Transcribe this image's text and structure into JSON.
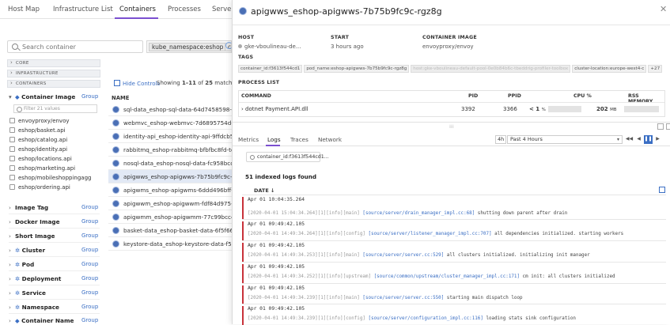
{
  "nav": {
    "tabs": [
      "Host Map",
      "Infrastructure List",
      "Containers",
      "Processes",
      "Serverless"
    ]
  },
  "left": {
    "search_placeholder": "Search container",
    "filter_chip": "kube_namespace:eshop ✖",
    "filter_chip2": "co",
    "sections": [
      "CORE",
      "INFRASTRUCTURE",
      "CONTAINERS"
    ],
    "container_image_label": "Container Image",
    "group_label": "Group",
    "filter_values_placeholder": "Filter 21 values",
    "images": [
      "envoyproxy/envoy",
      "eshop/basket.api",
      "eshop/catalog.api",
      "eshop/identity.api",
      "eshop/locations.api",
      "eshop/marketing.api",
      "eshop/mobileshoppingagg",
      "eshop/ordering.api"
    ],
    "facets": [
      "Image Tag",
      "Docker Image",
      "Short Image",
      "Cluster",
      "Pod",
      "Deployment",
      "Service",
      "Namespace",
      "Container Name"
    ]
  },
  "list": {
    "hide_controls": "Hide Controls",
    "showing_prefix": "Showing ",
    "showing_range": "1–11",
    "showing_of": " of ",
    "showing_count": "25",
    "showing_suffix": " matching co",
    "name_col": "NAME",
    "rows": [
      "sql-data_eshop-sql-data-64d7458598-892ln",
      "webmvc_eshop-webmvc-7d6895754d-7x4hn",
      "identity-api_eshop-identity-api-9ffdcb57b-jh7x",
      "rabbitmq_eshop-rabbitmq-bfbfbc8fd-tc6s2",
      "nosql-data_eshop-nosql-data-fc958bcc8-56n2v",
      "apigwws_eshop-apigwws-7b75b9fc9c-rgz8g",
      "apigwms_eshop-apigwms-6ddd496bff-pl9m6",
      "apigwwm_eshop-apigwwm-fdf84d975-29kcm",
      "apigwmm_eshop-apigwmm-77c99bcc47-69jqc",
      "basket-data_eshop-basket-data-6f5f6645b9-ktr",
      "keystore-data_eshop-keystore-data-f567cb6f5-"
    ]
  },
  "detail": {
    "title": "apigwws_eshop-apigwws-7b75b9fc9c-rgz8g",
    "host_label": "HOST",
    "host_value": "gke-vboulineau-de...",
    "start_label": "START",
    "start_value": "3 hours ago",
    "image_label": "CONTAINER IMAGE",
    "image_value": "envoyproxy/envoy",
    "tags_label": "TAGS",
    "tags": [
      "container_id:f3613f544cd1",
      "pod_name:eshop-apigwws-7b75b9fc9c-rgz8g",
      "host:gke-vboulineau-default-pool-0e0b84b6c-tbeddrig-profiler-toolbox",
      "cluster-location:europe-west4-c",
      "+27"
    ],
    "process_list_label": "PROCESS LIST",
    "proc_cols": [
      "COMMAND",
      "PID",
      "PPID",
      "CPU %",
      "RSS MEMORY"
    ],
    "proc": {
      "command": "dotnet Payment.API.dll",
      "pid": "3392",
      "ppid": "3366",
      "cpu": "< 1",
      "cpu_unit": "%",
      "rss": "202",
      "rss_unit": "MB"
    },
    "subtabs": [
      "Metrics",
      "Logs",
      "Traces",
      "Network"
    ],
    "range_chip": "4h",
    "range_label": "Past 4 Hours",
    "query": "container_id:f3613f544cd1...",
    "logs_found": "51 indexed logs found",
    "date_col": "DATE ↓",
    "logs": [
      {
        "ts": "Apr 01 10:04:35.264",
        "meta": "[2020-04-01 15:04:34.264][1][info][main]",
        "src": "[source/server/drain_manager_impl.cc:68]",
        "msg": " shutting down parent after drain"
      },
      {
        "ts": "Apr 01 09:49:42.105",
        "meta": "[2020-04-01 14:49:34.264][1][info][config]",
        "src": "[source/server/listener_manager_impl.cc:707]",
        "msg": " all dependencies initialized. starting workers"
      },
      {
        "ts": "Apr 01 09:49:42.105",
        "meta": "[2020-04-01 14:49:34.253][1][info][main]",
        "src": "[source/server/server.cc:529]",
        "msg": " all clusters initialized. initializing init manager"
      },
      {
        "ts": "Apr 01 09:49:42.105",
        "meta": "[2020-04-01 14:49:34.252][1][info][upstream]",
        "src": "[source/common/upstream/cluster_manager_impl.cc:171]",
        "msg": " cm init: all clusters initialized"
      },
      {
        "ts": "Apr 01 09:49:42.105",
        "meta": "[2020-04-01 14:49:34.239][1][info][main]",
        "src": "[source/server/server.cc:550]",
        "msg": " starting main dispatch loop"
      },
      {
        "ts": "Apr 01 09:49:42.105",
        "meta": "[2020-04-01 14:49:34.239][1][info][config]",
        "src": "[source/server/configuration_impl.cc:116]",
        "msg": " loading stats sink configuration"
      }
    ]
  },
  "colors": {
    "accent": "#7b4fd0",
    "link": "#3b6fc4",
    "error_bar": "#c8323a",
    "selected_row": "#e2e9f5"
  }
}
